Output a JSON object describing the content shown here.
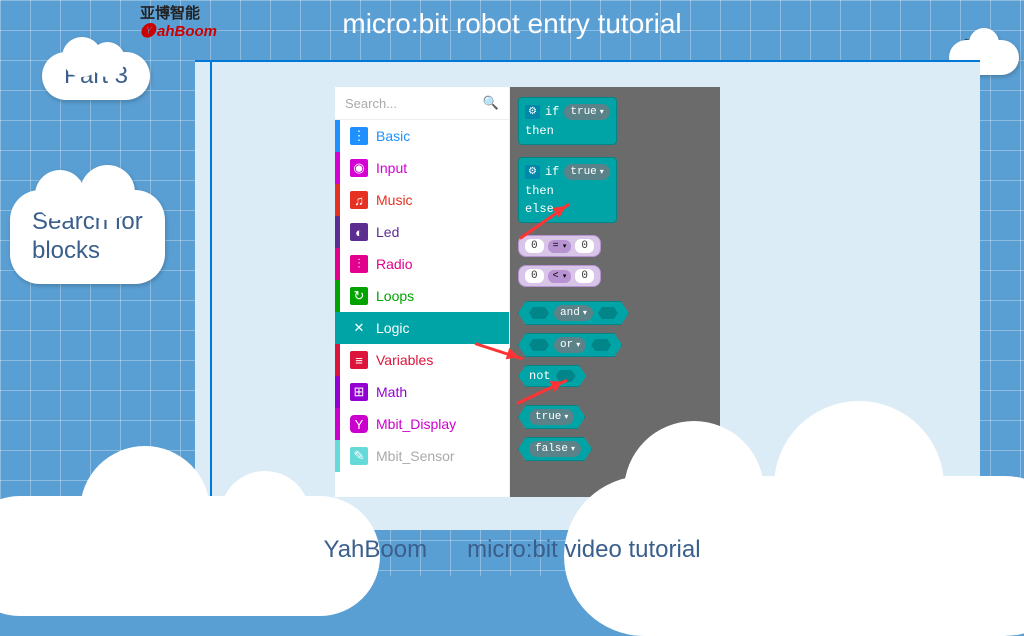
{
  "page": {
    "title": "micro:bit robot entry tutorial",
    "logo_cn": "亚博智能",
    "logo_en": "ahBoom",
    "part_label": "Part 3",
    "subtitle_l1": "Search for",
    "subtitle_l2": "blocks"
  },
  "footer": {
    "brand": "YahBoom",
    "text": "micro:bit video tutorial"
  },
  "editor": {
    "search_placeholder": "Search...",
    "categories": [
      {
        "key": "basic",
        "label": "Basic",
        "icon": "⋮⋮⋮"
      },
      {
        "key": "input",
        "label": "Input",
        "icon": "◉"
      },
      {
        "key": "music",
        "label": "Music",
        "icon": "♫"
      },
      {
        "key": "led",
        "label": "Led",
        "icon": "◐"
      },
      {
        "key": "radio",
        "label": "Radio",
        "icon": "⫶"
      },
      {
        "key": "loops",
        "label": "Loops",
        "icon": "↻"
      },
      {
        "key": "logic",
        "label": "Logic",
        "icon": "✕"
      },
      {
        "key": "vars",
        "label": "Variables",
        "icon": "≡"
      },
      {
        "key": "math",
        "label": "Math",
        "icon": "⊞"
      },
      {
        "key": "disp",
        "label": "Mbit_Display",
        "icon": "Y"
      },
      {
        "key": "sens",
        "label": "Mbit_Sensor",
        "icon": "✎"
      }
    ],
    "blocks": {
      "if_label": "if",
      "then_label": "then",
      "else_label": "else",
      "true_dd": "true",
      "false_dd": "false",
      "num_zero": "0",
      "op_eq": "=",
      "op_lt": "<",
      "op_and": "and",
      "op_or": "or",
      "not_label": "not"
    }
  }
}
